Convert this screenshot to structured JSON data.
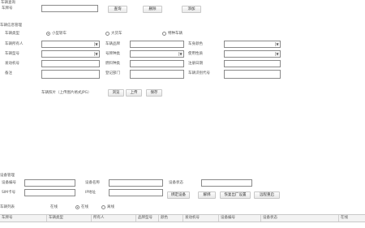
{
  "search": {
    "title": "车辆查询",
    "field_label": "车牌号",
    "field_value": "",
    "query_label": "查询",
    "delete_label": "删除",
    "add_label": "添加"
  },
  "vehicle": {
    "title": "车辆信息管理",
    "type_label": "车辆类型",
    "type_options": [
      "小型轿车",
      "大货车",
      "特种车辆"
    ],
    "type_selected": 0,
    "fields": {
      "owner_label": "车辆所有人",
      "owner_value": "",
      "brand_label": "车辆品牌",
      "brand_value": "",
      "body_color_label": "车身颜色",
      "body_color_value": "",
      "model_label": "车辆型号",
      "model_value": "",
      "plate_type_label": "号牌种类",
      "plate_type_value": "",
      "engine_label": "发动机号",
      "engine_value": "",
      "vin_label": "车辆识别代号",
      "vin_value": "",
      "usage_label": "使用性质",
      "usage_value": "",
      "fuel_label": "燃料种类",
      "fuel_value": "",
      "register_label": "注册日期",
      "register_value": "",
      "dept_label": "登记部门",
      "dept_value": "",
      "remark_label": "备注",
      "remark_value": ""
    },
    "photo_label": "车辆照片（上传图片格式JPG）",
    "browse_label": "浏览",
    "upload_label": "上传",
    "save_label": "保存"
  },
  "device": {
    "title": "设备管理",
    "sn_label": "设备编号",
    "sn_value": "",
    "name_label": "设备名称",
    "name_value": "",
    "status_label": "设备状态",
    "status_value": "",
    "sim_label": "SIM卡号",
    "sim_value": "",
    "ip_label": "IP地址",
    "ip_value": "",
    "bind_label": "绑定设备",
    "unbind_label": "解绑",
    "factory_label": "恢复出厂设置",
    "restart_label": "远程重启",
    "online_label": "在线",
    "online_options": [
      "在线",
      "离线"
    ],
    "online_selected": 0
  },
  "grid": {
    "title": "车辆列表",
    "columns": [
      "车牌号",
      "车辆类型",
      "所有人",
      "品牌型号",
      "颜色",
      "发动机号",
      "设备编号",
      "设备状态",
      "在线"
    ]
  }
}
